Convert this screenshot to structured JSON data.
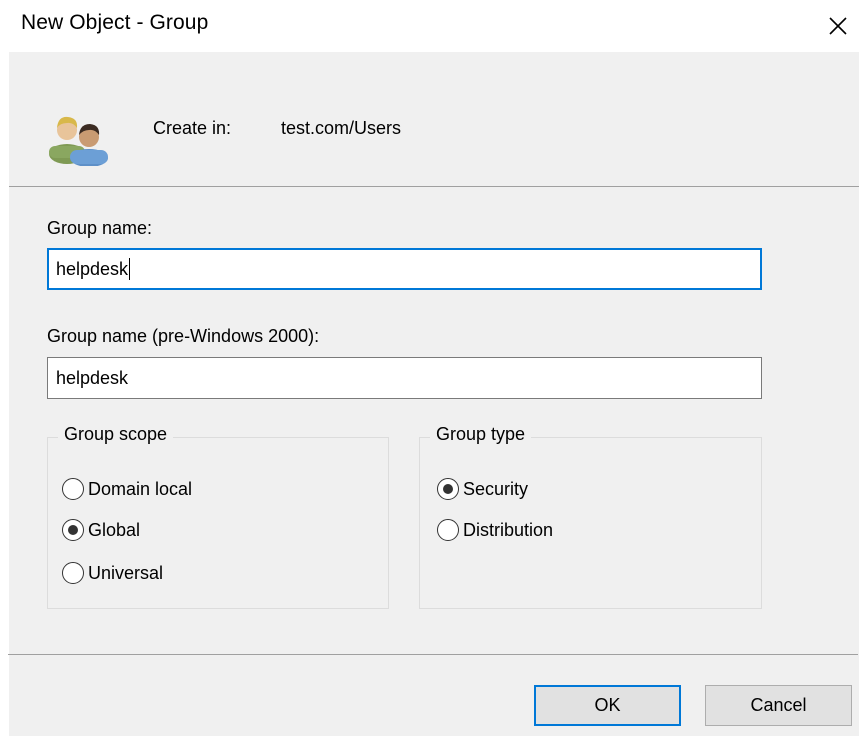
{
  "window": {
    "title": "New Object - Group"
  },
  "header": {
    "icon": "group-icon",
    "create_in_label": "Create in:",
    "create_in_value": "test.com/Users"
  },
  "fields": {
    "group_name_label": "Group name:",
    "group_name_value": "helpdesk",
    "pre2000_label": "Group name (pre-Windows 2000):",
    "pre2000_value": "helpdesk"
  },
  "group_scope": {
    "legend": "Group scope",
    "options": [
      {
        "label": "Domain local",
        "checked": false
      },
      {
        "label": "Global",
        "checked": true
      },
      {
        "label": "Universal",
        "checked": false
      }
    ]
  },
  "group_type": {
    "legend": "Group type",
    "options": [
      {
        "label": "Security",
        "checked": true
      },
      {
        "label": "Distribution",
        "checked": false
      }
    ]
  },
  "buttons": {
    "ok_label": "OK",
    "cancel_label": "Cancel"
  },
  "colors": {
    "focus_accent": "#0078d7",
    "dialog_background": "#f0f0f0",
    "button_face": "#e1e1e1"
  }
}
